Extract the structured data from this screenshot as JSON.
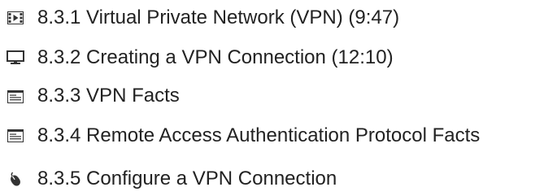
{
  "lessons": [
    {
      "label": "8.3.1 Virtual Private Network (VPN) (9:47)",
      "icon": "video-icon"
    },
    {
      "label": "8.3.2 Creating a VPN Connection (12:10)",
      "icon": "monitor-icon"
    },
    {
      "label": "8.3.3 VPN Facts",
      "icon": "document-icon"
    },
    {
      "label": "8.3.4 Remote Access Authentication Protocol Facts",
      "icon": "document-icon"
    },
    {
      "label": "8.3.5 Configure a VPN Connection",
      "icon": "mouse-icon"
    }
  ]
}
